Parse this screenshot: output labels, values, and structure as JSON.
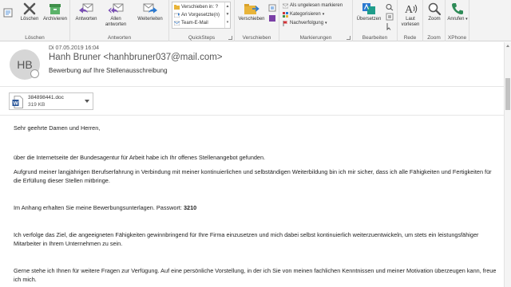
{
  "ribbon": {
    "delete_group": {
      "label": "Löschen",
      "buttons": [
        {
          "label": "Löschen",
          "icon": "delete-x-icon"
        },
        {
          "label": "Archivieren",
          "icon": "archive-icon"
        }
      ]
    },
    "respond_group": {
      "label": "Antworten",
      "buttons": [
        {
          "label": "Antworten",
          "icon": "reply-icon"
        },
        {
          "label": "Allen antworten",
          "line1": "Allen",
          "line2": "antworten",
          "icon": "reply-all-icon"
        },
        {
          "label": "Weiterleiten",
          "icon": "forward-icon"
        }
      ]
    },
    "quicksteps_group": {
      "label": "QuickSteps",
      "items": [
        {
          "label": "Verschieben in: ?",
          "icon": "folder-move-icon"
        },
        {
          "label": "An Vorgesetzte(n)",
          "icon": "manager-icon"
        },
        {
          "label": "Team-E-Mail",
          "icon": "team-mail-icon"
        }
      ]
    },
    "move_group": {
      "label": "Verschieben",
      "button": {
        "label": "Verschieben",
        "icon": "move-folder-icon"
      }
    },
    "tags_group": {
      "label": "Markierungen",
      "items": [
        {
          "label": "Als ungelesen markieren",
          "icon": "envelope-unread-icon"
        },
        {
          "label": "Kategorisieren",
          "icon": "categorize-icon"
        },
        {
          "label": "Nachverfolgung",
          "icon": "flag-icon"
        }
      ]
    },
    "edit_group": {
      "label": "Bearbeiten",
      "button": {
        "label": "Übersetzen",
        "icon": "translate-icon"
      }
    },
    "speech_group": {
      "label": "Rede",
      "button": {
        "line1": "Laut",
        "line2": "vorlesen",
        "icon": "read-aloud-icon"
      }
    },
    "zoom_group": {
      "label": "Zoom",
      "button": {
        "label": "Zoom",
        "icon": "magnifier-icon"
      }
    },
    "phone_group": {
      "label": "XPhone",
      "button": {
        "label": "Anrufen",
        "icon": "phone-icon"
      }
    }
  },
  "header": {
    "avatar_initials": "HB",
    "date": "Di 07.05.2019 16:04",
    "sender": "Hanh Bruner <hanhbruner037@mail.com>",
    "subject": "Bewerbung auf Ihre Stellenausschreibung"
  },
  "attachment": {
    "name": "384898441.doc",
    "size": "319 KB",
    "icon": "word-document-icon"
  },
  "body": {
    "greeting": "Sehr geehrte Damen und Herren,",
    "p1": "über die Internetseite der Bundesagentur für Arbeit habe ich Ihr offenes Stellenangebot gefunden.",
    "p2": "Aufgrund meiner langjährigen Berufserfahrung in Verbindung mit meiner kontinuierlichen und selbständigen Weiterbildung bin ich mir sicher, dass ich alle Fähigkeiten und Fertigkeiten für die Erfüllung dieser Stellen mitbringe.",
    "p3_text": "Im Anhang erhalten Sie meine Bewerbungsunterlagen. Passwort: ",
    "p3_password": "3210",
    "p4": "Ich verfolge das Ziel, die angeeigneten Fähigkeiten gewinnbringend für Ihre Firma einzusetzen und mich dabei selbst kontinuierlich weiterzuentwickeln, um stets ein leistungsfähiger Mitarbeiter in Ihrem Unternehmen zu sein.",
    "p5": "Gerne stehe ich Ihnen für weitere Fragen zur Verfügung. Auf eine persönliche Vorstellung, in der ich Sie von meinen fachlichen Kenntnissen und meiner Motivation überzeugen kann, freue ich mich."
  },
  "colors": {
    "ribbon_bg": "#f3f3f3",
    "accent_blue": "#2b79d0",
    "delete_gray": "#555555",
    "archive_green": "#3f8f4a",
    "flag_red": "#d13438",
    "phone_green": "#2e8b57"
  }
}
